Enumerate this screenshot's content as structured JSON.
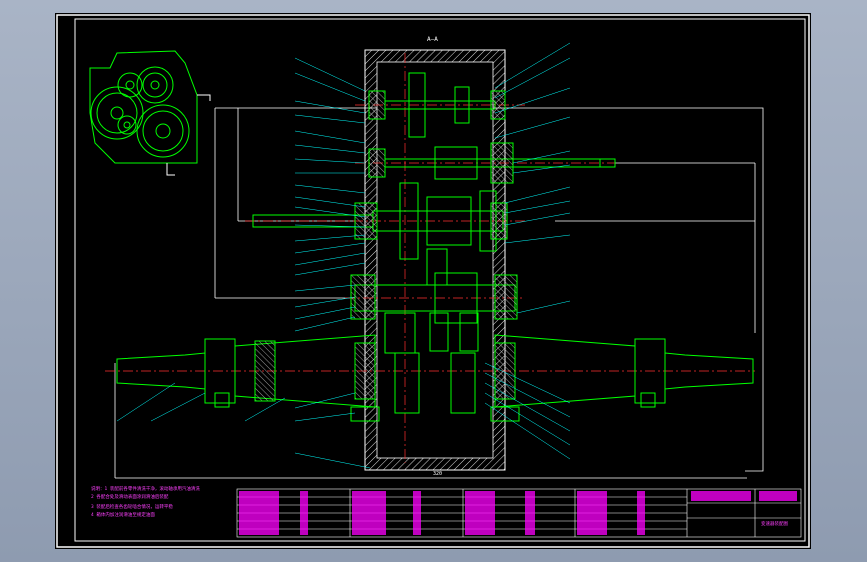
{
  "drawing": {
    "section_label": "A—A",
    "dimension_bottom": "320",
    "notes": [
      "说明：1  装配前各零件清洗干净，滚动轴承用汽油清洗",
      "         2  各配合处及滑动表面涂润滑油后装配",
      "         3  装配后检查各齿轮啮合情况，运转平稳",
      "         4  箱体内加注润滑油至规定油面"
    ],
    "title_block_name": "变速器装配图"
  },
  "colors": {
    "background": "#000000",
    "frame": "#ffffff",
    "geometry": "#00ff00",
    "leader": "#00ffff",
    "centerline": "#ff0000",
    "text": "#ff00ff",
    "hatch": "#ffffff"
  }
}
